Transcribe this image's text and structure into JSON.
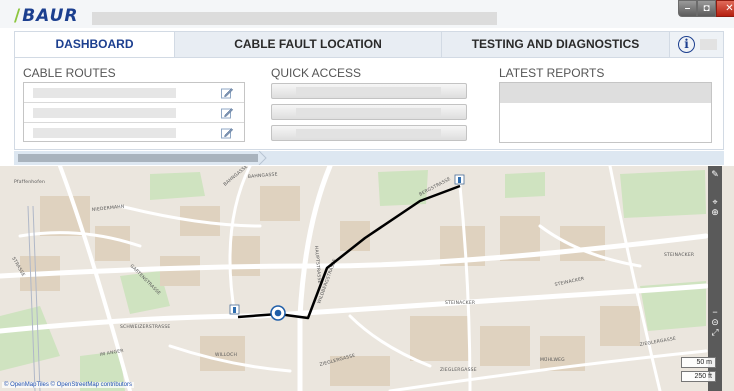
{
  "app": {
    "logo": "BAUR",
    "window_controls": {
      "minimize": "–",
      "maximize": "◘",
      "close": "✕"
    }
  },
  "tabs": [
    {
      "label": "DASHBOARD",
      "active": true
    },
    {
      "label": "CABLE FAULT LOCATION",
      "active": false
    },
    {
      "label": "TESTING AND DIAGNOSTICS",
      "active": false
    }
  ],
  "dashboard": {
    "cable_routes_title": "CABLE ROUTES",
    "quick_access_title": "QUICK ACCESS",
    "latest_reports_title": "LATEST REPORTS"
  },
  "map": {
    "attribution": "© OpenMapTiles © OpenStreetMap contributors",
    "scale_metric": "50 m",
    "scale_imperial": "250 ft",
    "streets": {
      "s1": "NIEDERMAHN",
      "s2": "BAHNGASSE",
      "s3": "BAHNGASSE",
      "s4": "HAUPTSTRASSE",
      "s5": "WILDBERGSTRASSE",
      "s6": "BERGSTRASSE",
      "s7": "STEINACKER",
      "s8": "STEINACKER",
      "s9": "STEINACKER",
      "s10": "SCHWEIZERSTRASSE",
      "s11": "IM ANGER",
      "s12": "WILLOCH",
      "s13": "ZIEGLERGASSE",
      "s14": "ZIEGLERGASSE",
      "s15": "ZIEGLERGASSE",
      "s16": "GARTENSTRASSE",
      "s17": "MÜHLWEG",
      "s18": "STRASSE"
    },
    "area_label": "Pfaffenhofen"
  },
  "colors": {
    "brand_blue": "#1c3f8f",
    "accent_green": "#8dc63f",
    "route_line": "#000000"
  }
}
